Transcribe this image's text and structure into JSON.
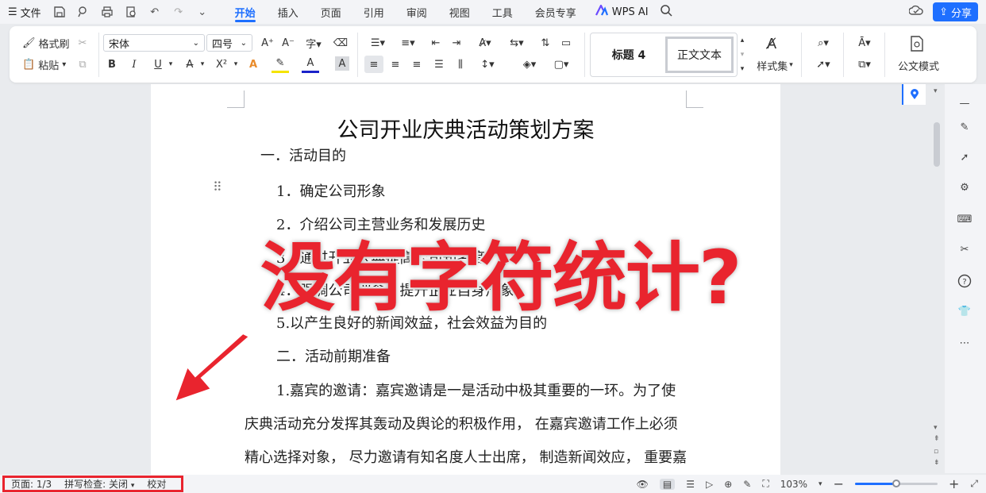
{
  "menubar": {
    "file_label": "文件",
    "tabs": [
      "开始",
      "插入",
      "页面",
      "引用",
      "审阅",
      "视图",
      "工具",
      "会员专享"
    ],
    "active_tab": "开始",
    "wps_ai_label": "WPS AI",
    "share_label": "分享",
    "accent_color": "#1e6fff"
  },
  "ribbon": {
    "format_painter_label": "格式刷",
    "paste_label": "粘贴",
    "font_name": "宋体",
    "font_size": "四号",
    "bold": "B",
    "italic": "I",
    "underline": "U",
    "strike": "A",
    "superscript": "X²",
    "styles": [
      "标题 4",
      "正文文本"
    ],
    "style_set_label": "样式集",
    "official_mode_label": "公文模式"
  },
  "document": {
    "title": "公司开业庆典活动策划方案",
    "lines": [
      "一．活动目的",
      "1．确定公司形象",
      "2．介绍公司主营业务和发展历史",
      "3．通过开业庆典提高公司知名度",
      "4．强调公司理念，提升企业自身形象",
      "5.以产生良好的新闻效益，社会效益为目的",
      "二．活动前期准备",
      "1.嘉宾的邀请：嘉宾邀请是一是活动中极其重要的一环。为了使",
      "庆典活动充分发挥其轰动及舆论的积极作用， 在嘉宾邀请工作上必须",
      "精心选择对象， 尽力邀请有知名度人士出席， 制造新闻效应， 重要嘉"
    ]
  },
  "overlay": {
    "text": "没有字符统计?",
    "color": "#e9242e"
  },
  "statusbar": {
    "page_info": "页面: 1/3",
    "spell_check": "拼写检查: 关闭",
    "proofread": "校对",
    "zoom": "103%",
    "zoom_level_percent": 50
  }
}
